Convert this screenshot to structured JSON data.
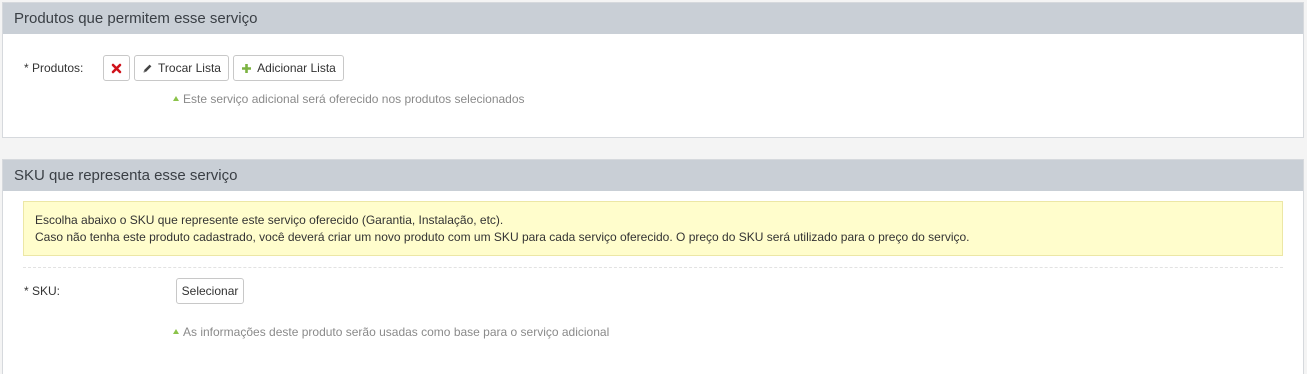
{
  "products_section": {
    "title": "Produtos que permitem esse serviço",
    "field_label": "* Produtos:",
    "remove_icon": "close-icon",
    "change_list_label": "Trocar Lista",
    "change_list_icon": "pencil-icon",
    "add_list_label": "Adicionar Lista",
    "add_list_icon": "plus-icon",
    "hint": "Este serviço adicional será oferecido nos produtos selecionados"
  },
  "sku_section": {
    "title": "SKU que representa esse serviço",
    "alert_line_1": "Escolha abaixo o SKU que represente este serviço oferecido (Garantia, Instalação, etc).",
    "alert_line_2": "Caso não tenha este produto cadastrado, você deverá criar um novo produto com um SKU para cada serviço oferecido. O preço do SKU será utilizado para o preço do serviço.",
    "field_label": "* SKU:",
    "select_label": "Selecionar",
    "hint": "As informações deste produto serão usadas como base para o serviço adicional"
  },
  "colors": {
    "header_bg": "#c9cfd6",
    "remove_icon": "#d0121b",
    "add_icon": "#7cb342",
    "hint_caret": "#8bc34a",
    "alert_bg": "#fffdcc"
  }
}
